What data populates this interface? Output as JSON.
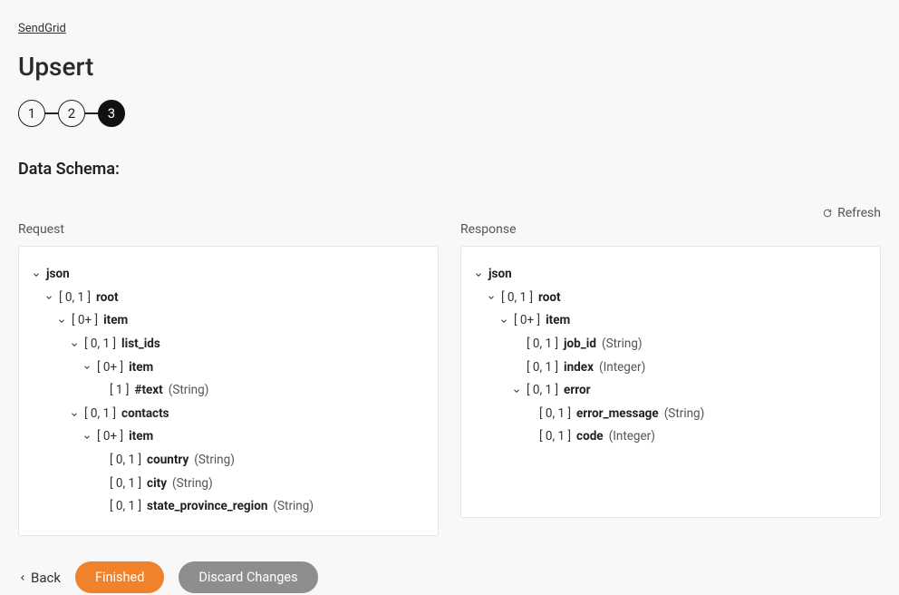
{
  "breadcrumb": "SendGrid",
  "page_title": "Upsert",
  "stepper": {
    "steps": [
      "1",
      "2",
      "3"
    ],
    "active_index": 2
  },
  "section_title": "Data Schema:",
  "refresh_label": "Refresh",
  "columns": {
    "request_label": "Request",
    "response_label": "Response"
  },
  "request_tree": [
    {
      "depth": 0,
      "expandable": true,
      "card": "",
      "name": "json",
      "type": ""
    },
    {
      "depth": 1,
      "expandable": true,
      "card": "[ 0, 1 ]",
      "name": "root",
      "type": ""
    },
    {
      "depth": 2,
      "expandable": true,
      "card": "[ 0+ ]",
      "name": "item",
      "type": ""
    },
    {
      "depth": 3,
      "expandable": true,
      "card": "[ 0, 1 ]",
      "name": "list_ids",
      "type": ""
    },
    {
      "depth": 4,
      "expandable": true,
      "card": "[ 0+ ]",
      "name": "item",
      "type": ""
    },
    {
      "depth": 5,
      "expandable": false,
      "card": "[ 1 ]",
      "name": "#text",
      "type": "(String)"
    },
    {
      "depth": 3,
      "expandable": true,
      "card": "[ 0, 1 ]",
      "name": "contacts",
      "type": ""
    },
    {
      "depth": 4,
      "expandable": true,
      "card": "[ 0+ ]",
      "name": "item",
      "type": ""
    },
    {
      "depth": 5,
      "expandable": false,
      "card": "[ 0, 1 ]",
      "name": "country",
      "type": "(String)"
    },
    {
      "depth": 5,
      "expandable": false,
      "card": "[ 0, 1 ]",
      "name": "city",
      "type": "(String)"
    },
    {
      "depth": 5,
      "expandable": false,
      "card": "[ 0, 1 ]",
      "name": "state_province_region",
      "type": "(String)"
    }
  ],
  "response_tree": [
    {
      "depth": 0,
      "expandable": true,
      "card": "",
      "name": "json",
      "type": ""
    },
    {
      "depth": 1,
      "expandable": true,
      "card": "[ 0, 1 ]",
      "name": "root",
      "type": ""
    },
    {
      "depth": 2,
      "expandable": true,
      "card": "[ 0+ ]",
      "name": "item",
      "type": ""
    },
    {
      "depth": 3,
      "expandable": false,
      "card": "[ 0, 1 ]",
      "name": "job_id",
      "type": "(String)"
    },
    {
      "depth": 3,
      "expandable": false,
      "card": "[ 0, 1 ]",
      "name": "index",
      "type": "(Integer)"
    },
    {
      "depth": 3,
      "expandable": true,
      "card": "[ 0, 1 ]",
      "name": "error",
      "type": ""
    },
    {
      "depth": 4,
      "expandable": false,
      "card": "[ 0, 1 ]",
      "name": "error_message",
      "type": "(String)"
    },
    {
      "depth": 4,
      "expandable": false,
      "card": "[ 0, 1 ]",
      "name": "code",
      "type": "(Integer)"
    }
  ],
  "buttons": {
    "back": "Back",
    "finished": "Finished",
    "discard": "Discard Changes"
  }
}
